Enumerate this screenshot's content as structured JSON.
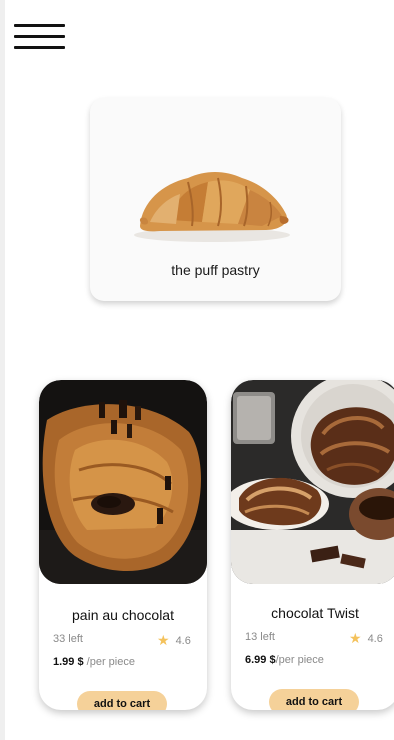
{
  "header": {
    "menu_icon": "hamburger-menu-icon"
  },
  "hero": {
    "label": "the puff pastry",
    "image": "croissant-image"
  },
  "products": [
    {
      "name": "pain au chocolat",
      "stock": "33 left",
      "rating": "4.6",
      "price": "1.99 $",
      "unit": "/per piece",
      "cta": "add to cart",
      "image": "pain-au-chocolat-image"
    },
    {
      "name": "chocolat Twist",
      "stock": "13 left",
      "rating": "4.6",
      "price": "6.99 $",
      "unit": "/per piece",
      "cta": "add to cart",
      "image": "chocolate-twist-image"
    }
  ],
  "colors": {
    "accent": "#f5d199",
    "star": "#f4c25c",
    "muted_text": "#8a8a8a",
    "card_bg": "#fafafa"
  }
}
